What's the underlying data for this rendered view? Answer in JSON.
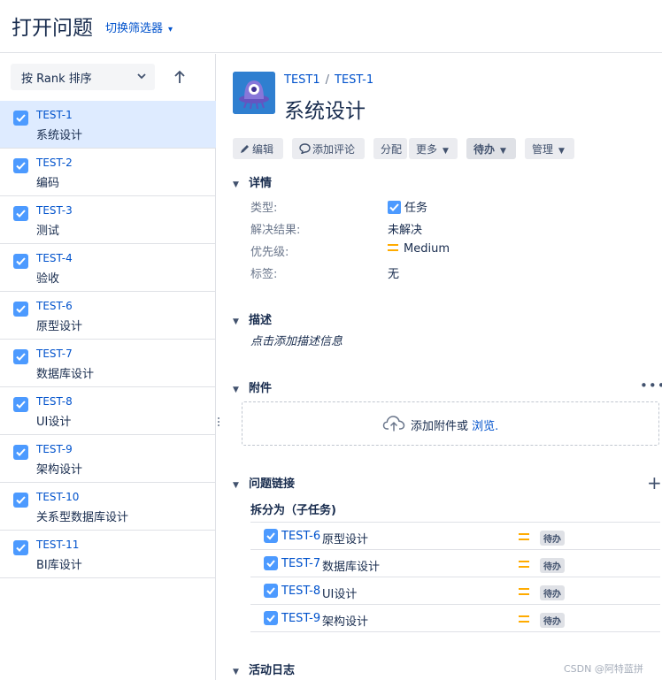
{
  "header": {
    "title": "打开问题",
    "filter_switch": "切换筛选器"
  },
  "sidebar": {
    "sort_label": "按 Rank 排序",
    "items": [
      {
        "key": "TEST-1",
        "summary": "系统设计"
      },
      {
        "key": "TEST-2",
        "summary": "编码"
      },
      {
        "key": "TEST-3",
        "summary": "测试"
      },
      {
        "key": "TEST-4",
        "summary": "验收"
      },
      {
        "key": "TEST-6",
        "summary": "原型设计"
      },
      {
        "key": "TEST-7",
        "summary": "数据库设计"
      },
      {
        "key": "TEST-8",
        "summary": "UI设计"
      },
      {
        "key": "TEST-9",
        "summary": "架构设计"
      },
      {
        "key": "TEST-10",
        "summary": "关系型数据库设计"
      },
      {
        "key": "TEST-11",
        "summary": "BI库设计"
      }
    ],
    "selected_index": 0
  },
  "issue": {
    "project": "TEST1",
    "key": "TEST-1",
    "title": "系统设计",
    "toolbar": {
      "edit": "编辑",
      "comment": "添加评论",
      "assign": "分配",
      "more": "更多",
      "status": "待办",
      "admin": "管理"
    },
    "details": {
      "heading": "详情",
      "type_label": "类型:",
      "type_value": "任务",
      "resolution_label": "解决结果:",
      "resolution_value": "未解决",
      "priority_label": "优先级:",
      "priority_value": "Medium",
      "labels_label": "标签:",
      "labels_value": "无"
    },
    "description": {
      "heading": "描述",
      "placeholder": "点击添加描述信息"
    },
    "attachments": {
      "heading": "附件",
      "more": "•••",
      "drop_text": "添加附件或",
      "browse": "浏览."
    },
    "links": {
      "heading": "问题链接",
      "subheading": "拆分为（子任务)",
      "items": [
        {
          "key": "TEST-6",
          "summary": "原型设计",
          "status": "待办"
        },
        {
          "key": "TEST-7",
          "summary": "数据库设计",
          "status": "待办"
        },
        {
          "key": "TEST-8",
          "summary": "UI设计",
          "status": "待办"
        },
        {
          "key": "TEST-9",
          "summary": "架构设计",
          "status": "待办"
        }
      ]
    },
    "activity": {
      "heading": "活动日志"
    }
  },
  "watermark": "CSDN @阿特蓝拼",
  "colors": {
    "link": "#0052cc",
    "accent_checkbox": "#4c9aff",
    "priority_medium": "#ffab00",
    "selected_row": "#deebff"
  }
}
